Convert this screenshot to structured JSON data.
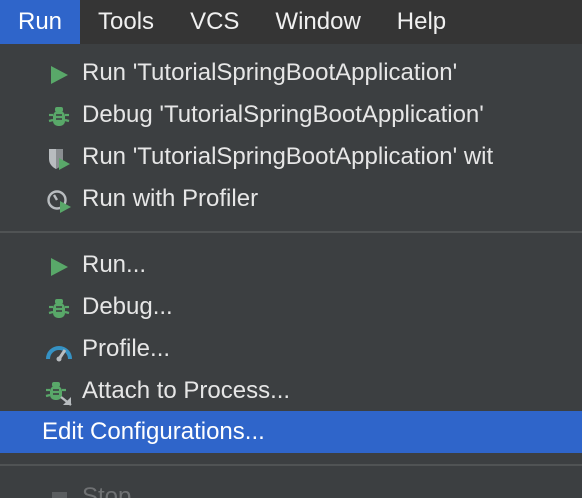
{
  "menubar": {
    "items": [
      "Run",
      "Tools",
      "VCS",
      "Window",
      "Help"
    ],
    "active": "Run"
  },
  "run_menu": {
    "items": [
      {
        "label": "Run 'TutorialSpringBootApplication'",
        "icon": "run-icon"
      },
      {
        "label": "Debug 'TutorialSpringBootApplication'",
        "icon": "debug-icon"
      },
      {
        "label": "Run 'TutorialSpringBootApplication' wit",
        "icon": "coverage-icon"
      },
      {
        "label": "Run with Profiler",
        "icon": "profiler-run-icon"
      },
      {
        "label": "Run...",
        "icon": "run-icon"
      },
      {
        "label": "Debug...",
        "icon": "debug-icon"
      },
      {
        "label": "Profile...",
        "icon": "profile-gauge-icon"
      },
      {
        "label": "Attach to Process...",
        "icon": "attach-debug-icon"
      },
      {
        "label": "Edit Configurations...",
        "icon": ""
      },
      {
        "label": "Stop",
        "icon": "stop-icon"
      }
    ],
    "selected": "Edit Configurations..."
  },
  "colors": {
    "accent": "#2f65ca",
    "menu_bg": "#3c3f41",
    "run_green": "#59a869",
    "profiler_blue": "#3592c4"
  }
}
